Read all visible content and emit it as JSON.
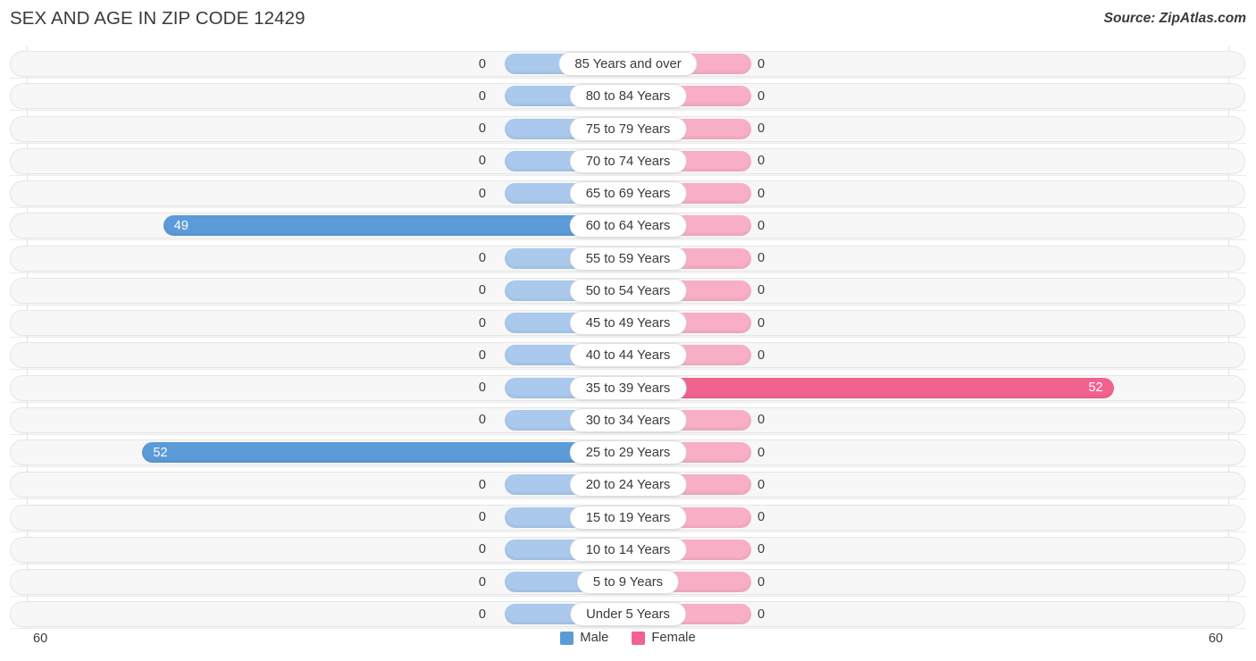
{
  "header": {
    "title": "SEX AND AGE IN ZIP CODE 12429",
    "source": "Source: ZipAtlas.com"
  },
  "axis": {
    "left_max_label": "60",
    "right_max_label": "60",
    "max": 60
  },
  "legend": {
    "items": [
      {
        "label": "Male",
        "color": "#5b9bd8",
        "name": "legend-male"
      },
      {
        "label": "Female",
        "color": "#f2628f",
        "name": "legend-female"
      }
    ]
  },
  "colors": {
    "male": "#5b9bd8",
    "female": "#f2628f",
    "male_zero": "#aac9ec",
    "female_zero": "#f8afc6",
    "track": "#f7f7f7",
    "text": "#3a3a3a"
  },
  "chart_data": {
    "type": "bar",
    "title": "SEX AND AGE IN ZIP CODE 12429",
    "subtitle": "",
    "xlabel": "",
    "ylabel": "",
    "orientation": "horizontal",
    "layout": "population-pyramid",
    "xlim": [
      0,
      60
    ],
    "grid": true,
    "legend_position": "bottom-center",
    "categories": [
      "85 Years and over",
      "80 to 84 Years",
      "75 to 79 Years",
      "70 to 74 Years",
      "65 to 69 Years",
      "60 to 64 Years",
      "55 to 59 Years",
      "50 to 54 Years",
      "45 to 49 Years",
      "40 to 44 Years",
      "35 to 39 Years",
      "30 to 34 Years",
      "25 to 29 Years",
      "20 to 24 Years",
      "15 to 19 Years",
      "10 to 14 Years",
      "5 to 9 Years",
      "Under 5 Years"
    ],
    "series": [
      {
        "name": "Male",
        "values": [
          0,
          0,
          0,
          0,
          0,
          49,
          0,
          0,
          0,
          0,
          0,
          0,
          52,
          0,
          0,
          0,
          0,
          0
        ]
      },
      {
        "name": "Female",
        "values": [
          0,
          0,
          0,
          0,
          0,
          0,
          0,
          0,
          0,
          0,
          52,
          0,
          0,
          0,
          0,
          0,
          0,
          0
        ]
      }
    ],
    "value_labels": {
      "Male": [
        "0",
        "0",
        "0",
        "0",
        "0",
        "49",
        "0",
        "0",
        "0",
        "0",
        "0",
        "0",
        "52",
        "0",
        "0",
        "0",
        "0",
        "0"
      ],
      "Female": [
        "0",
        "0",
        "0",
        "0",
        "0",
        "0",
        "0",
        "0",
        "0",
        "0",
        "52",
        "0",
        "0",
        "0",
        "0",
        "0",
        "0",
        "0"
      ]
    }
  }
}
